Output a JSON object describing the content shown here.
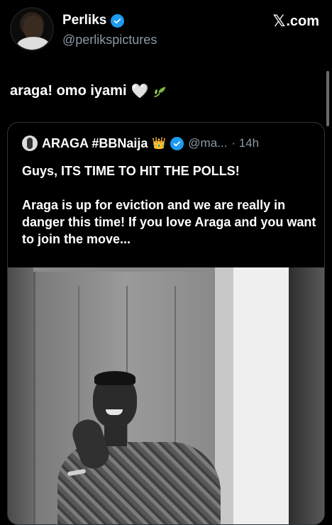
{
  "author": {
    "display_name": "Perliks",
    "handle": "@perlikspictures"
  },
  "brand": {
    "label": ".com"
  },
  "tweet": {
    "text": "araga! omo iyami"
  },
  "quoted": {
    "display_name": "ARAGA #BBNaija",
    "handle": "@ma...",
    "time": "· 14h",
    "paragraph1": "Guys, ITS TIME TO HIT THE POLLS!",
    "paragraph2": "Araga is up for eviction and we are really in danger this time! If you love Araga and you want to join the move..."
  },
  "colors": {
    "verified": "#1d9bf0",
    "background": "#000000",
    "muted_text": "#8b98a5"
  },
  "icons": {
    "verified": "verified-badge-icon",
    "brand": "x-logo-icon",
    "heart": "white-heart-icon",
    "leaf": "leaf-icon",
    "crown": "crown-icon"
  }
}
